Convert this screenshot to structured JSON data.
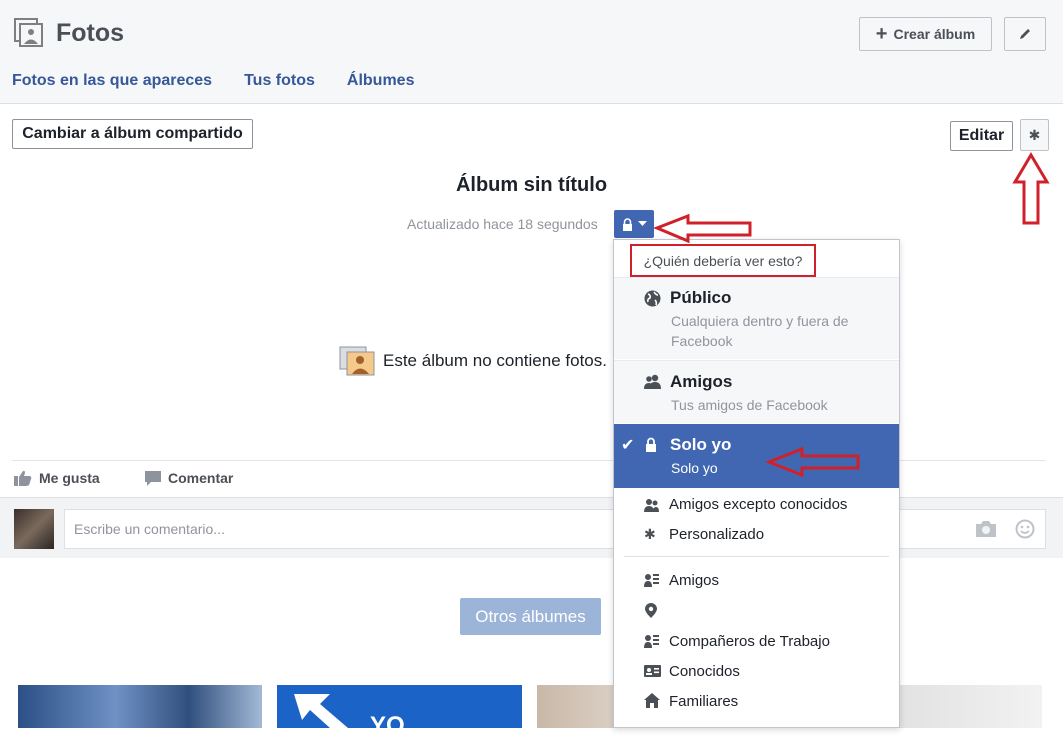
{
  "header": {
    "title": "Fotos",
    "tabs": [
      "Fotos en las que apareces",
      "Tus fotos",
      "Álbumes"
    ],
    "create_album_label": "Crear álbum"
  },
  "album": {
    "shared_label": "Cambiar a álbum compartido",
    "edit_label": "Editar",
    "title": "Álbum sin título",
    "updated": "Actualizado hace 18 segundos",
    "empty_text": "Este álbum no contiene fotos."
  },
  "actions": {
    "like": "Me gusta",
    "comment": "Comentar"
  },
  "comment": {
    "placeholder": "Escribe un comentario..."
  },
  "other_albums": "Otros álbumes",
  "thumbnail_text": "YO",
  "privacy_menu": {
    "header": "¿Quién debería ver esto?",
    "options": [
      {
        "title": "Público",
        "desc": "Cualquiera dentro y fuera de Facebook",
        "icon": "globe-icon"
      },
      {
        "title": "Amigos",
        "desc": "Tus amigos de Facebook",
        "icon": "friends-icon"
      },
      {
        "title": "Solo yo",
        "desc": "Solo yo",
        "icon": "lock-icon",
        "selected": true
      }
    ],
    "more_options": [
      {
        "label": "Amigos excepto conocidos",
        "icon": "friends-except-icon"
      },
      {
        "label": "Personalizado",
        "icon": "gear-icon"
      }
    ],
    "lists": [
      {
        "label": "Amigos",
        "icon": "list-icon"
      },
      {
        "label": "",
        "icon": "location-pin-icon"
      },
      {
        "label": "Compañeros de Trabajo",
        "icon": "list-icon"
      },
      {
        "label": "Conocidos",
        "icon": "id-card-icon"
      },
      {
        "label": "Familiares",
        "icon": "house-icon"
      }
    ]
  },
  "colors": {
    "accent": "#4267b2",
    "link": "#365899",
    "annotation": "#d0202a"
  }
}
